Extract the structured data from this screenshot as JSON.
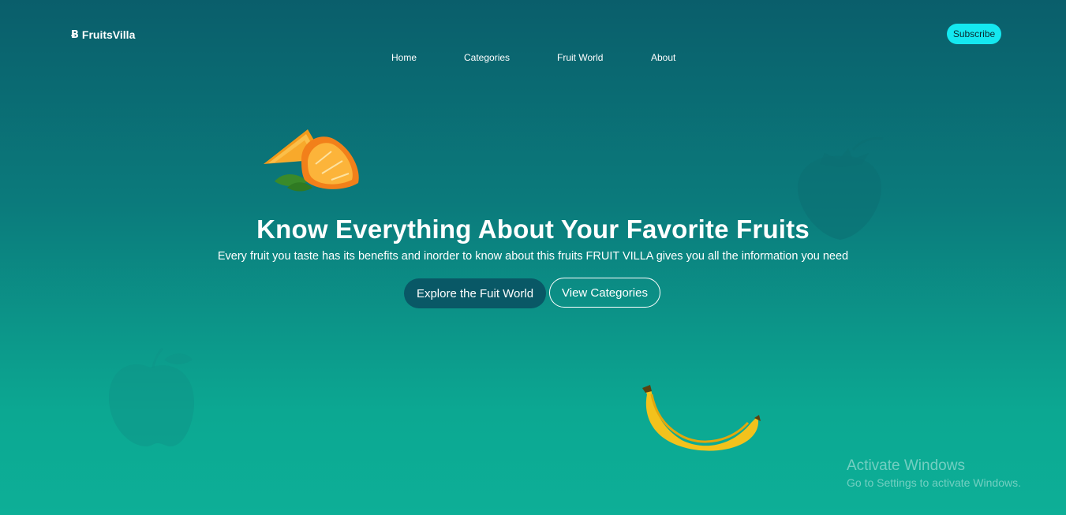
{
  "brand": {
    "icon": "bitcoin-b-icon",
    "name": "FruitsVilla"
  },
  "nav": {
    "items": [
      {
        "label": "Home"
      },
      {
        "label": "Categories"
      },
      {
        "label": "Fruit World"
      },
      {
        "label": "About"
      }
    ]
  },
  "header": {
    "subscribe_label": "Subscribe"
  },
  "hero": {
    "title": "Know Everything About Your Favorite Fruits",
    "subtitle": "Every fruit you taste has its benefits and inorder to know about this fruits FRUIT VILLA gives you all the information you need",
    "primary_button": "Explore the Fuit World",
    "secondary_button": "View Categories"
  },
  "decorations": {
    "orange": "orange-slices-image",
    "strawberry": "strawberry-silhouette-image",
    "apple": "apple-silhouette-image",
    "banana": "banana-image"
  },
  "colors": {
    "bg_top": "#0a5e6b",
    "bg_bottom": "#0daf97",
    "accent": "#14e8f0",
    "primary_button": "#095866"
  },
  "os_watermark": {
    "title": "Activate Windows",
    "subtitle": "Go to Settings to activate Windows."
  }
}
